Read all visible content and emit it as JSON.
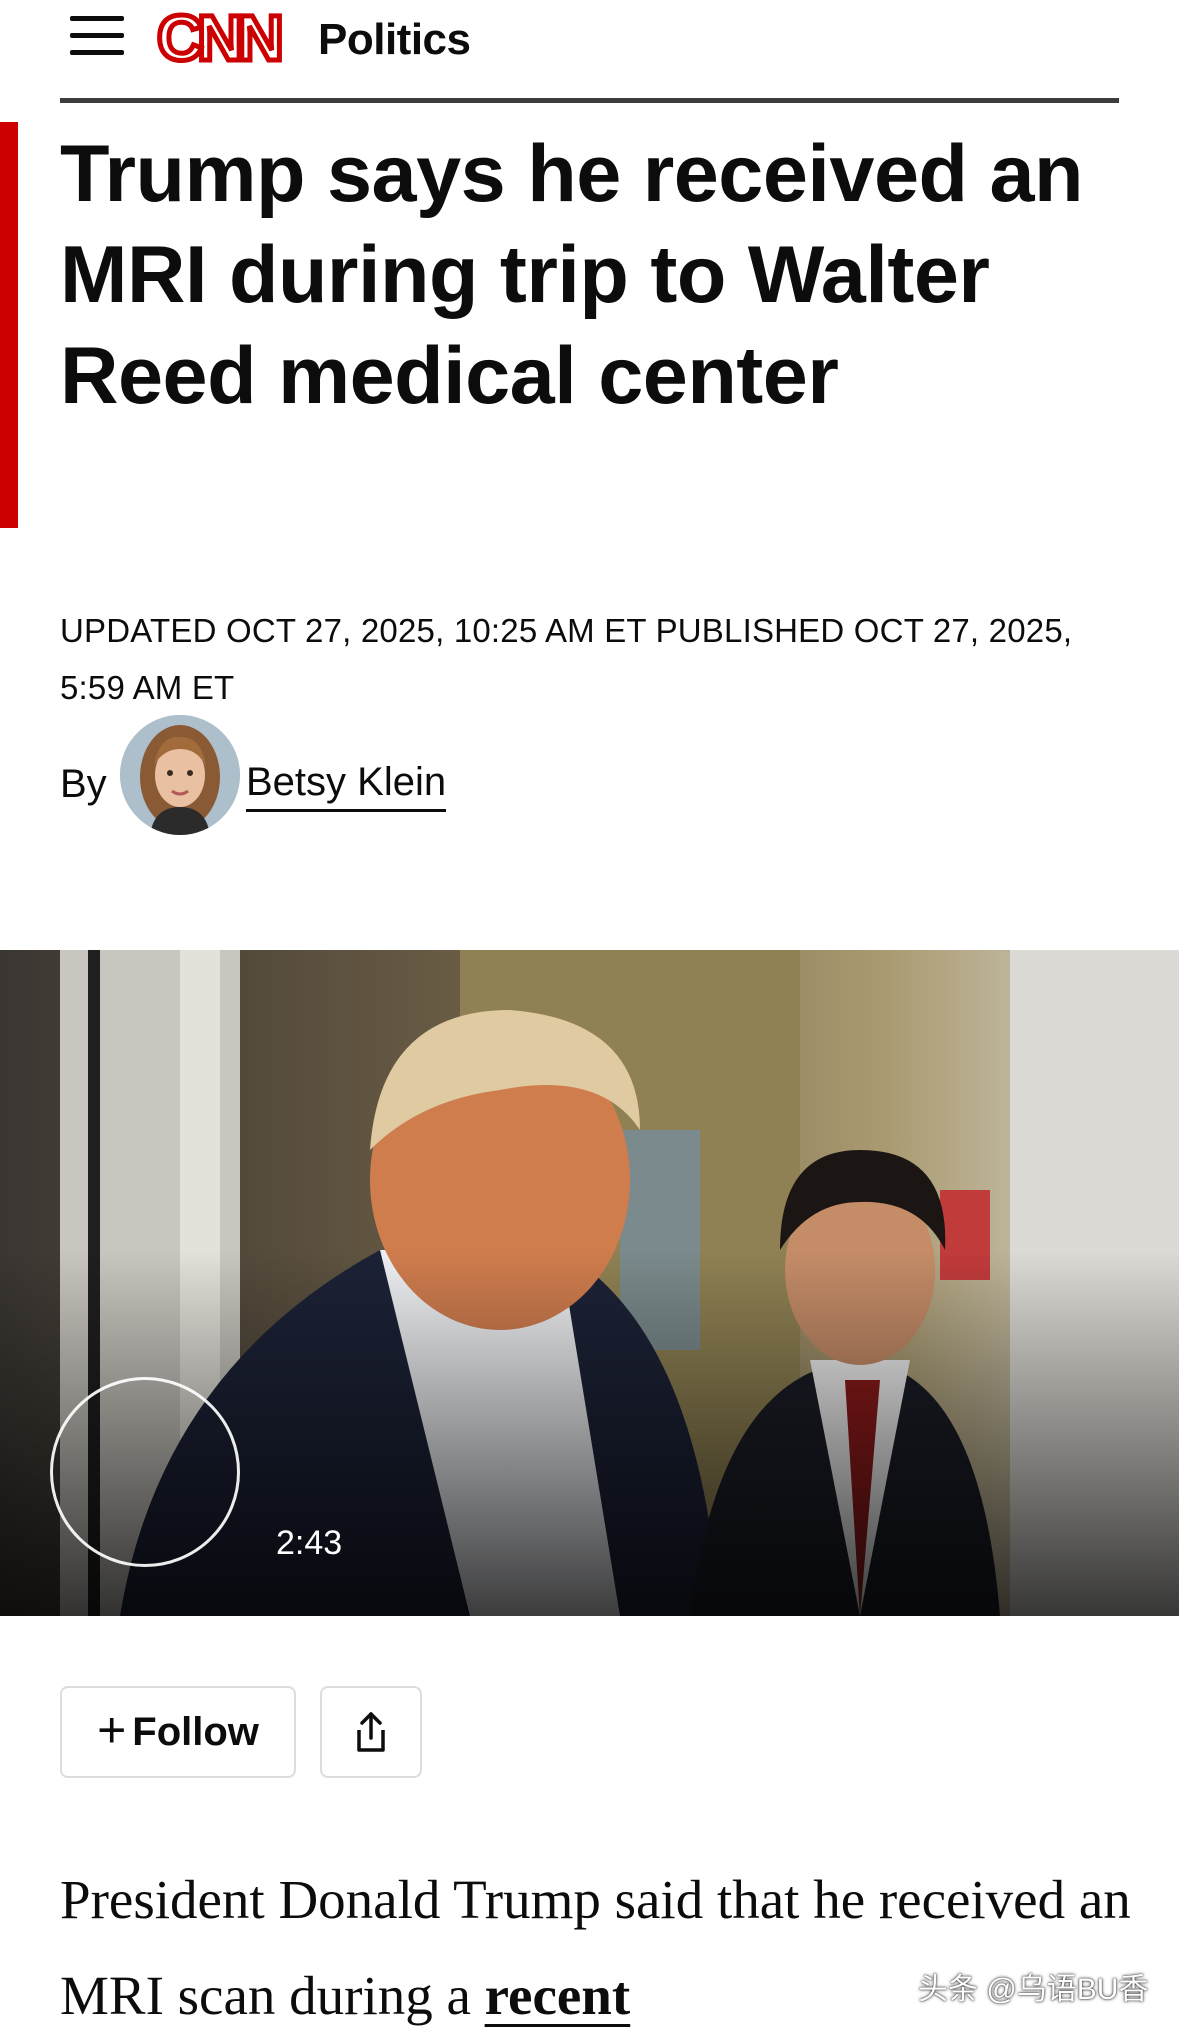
{
  "header": {
    "logo_text": "CNN",
    "section": "Politics",
    "brand_color": "#cc0000"
  },
  "article": {
    "headline": "Trump says he received an MRI during trip to Walter Reed medical center",
    "timestamp": "UPDATED OCT 27, 2025, 10:25 AM ET PUBLISHED OCT 27, 2025, 5:59 AM ET",
    "byline_prefix": "By",
    "author": "Betsy Klein",
    "paragraph_start": "President Donald Trump said that he received an MRI scan during a ",
    "paragraph_link": "recent"
  },
  "video": {
    "duration": "2:43",
    "play_icon": "play-ring-icon"
  },
  "actions": {
    "follow_icon": "+",
    "follow_label": "Follow",
    "share_icon": "share-icon"
  },
  "watermark": "头条 @乌语BU香"
}
